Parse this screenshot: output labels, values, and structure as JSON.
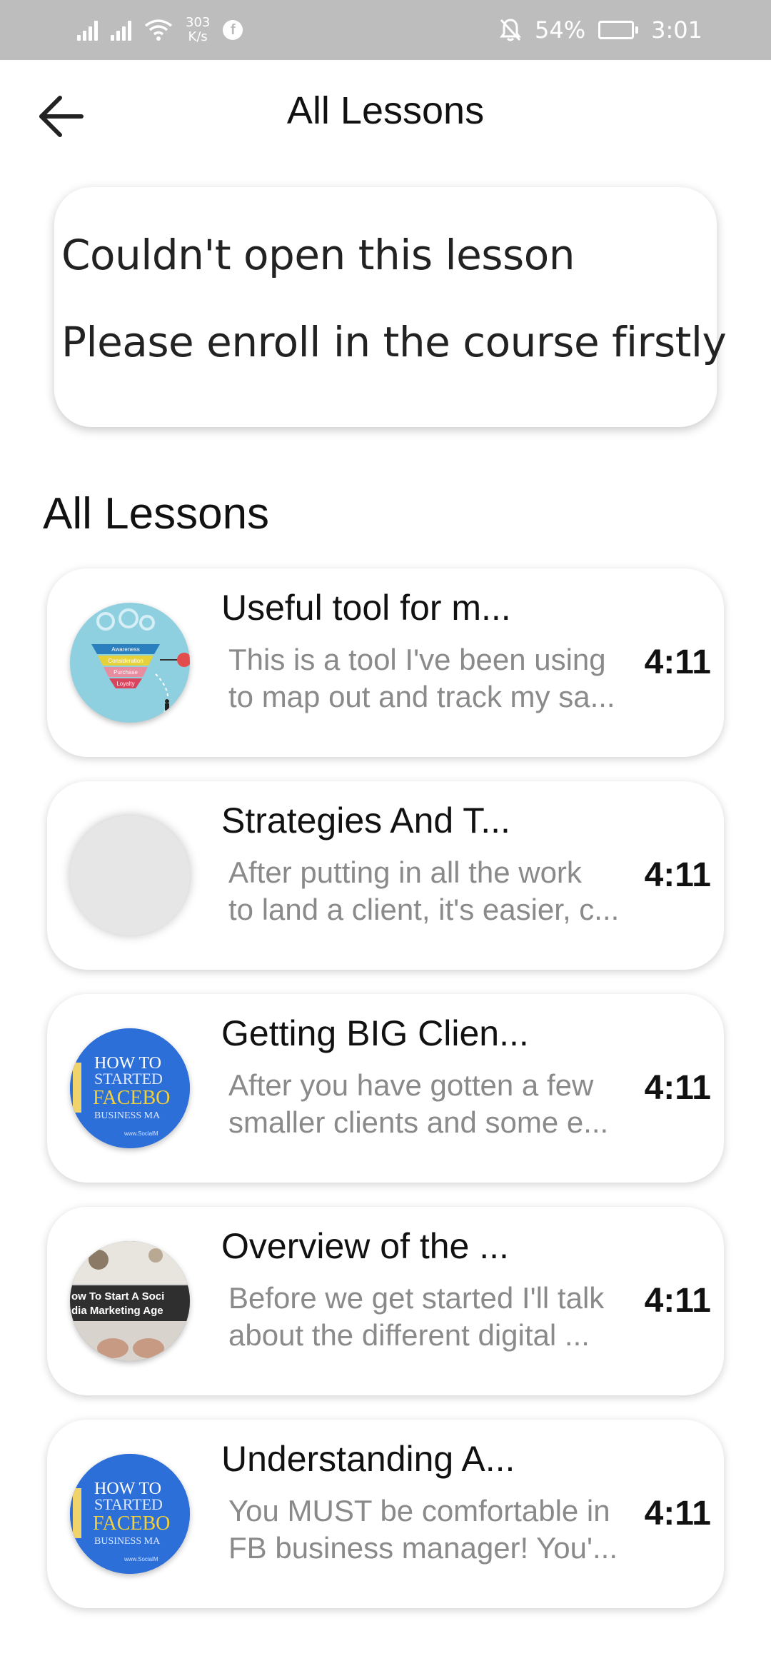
{
  "status_bar": {
    "net_speed_value": "303",
    "net_speed_unit": "K/s",
    "battery": "54%",
    "time": "3:01",
    "battery_level": 0.54,
    "icons": [
      "signal-icon",
      "signal-icon",
      "wifi-icon",
      "facebook-icon",
      "bell-off-icon",
      "battery-icon"
    ]
  },
  "header": {
    "title": "All Lessons"
  },
  "error": {
    "line1": "Couldn't open this lesson",
    "line2": "Please enroll in the course firstly"
  },
  "section": {
    "title": "All Lessons"
  },
  "lessons": [
    {
      "title": "Useful tool for m...",
      "desc_line1": "This is a tool I've been using",
      "desc_line2": "to map out and track my sa...",
      "duration": "4:11",
      "thumb_labels": [
        "Awareness",
        "Consideration",
        "Purchase",
        "Loyalty"
      ]
    },
    {
      "title": "Strategies And T...",
      "desc_line1": "After putting in all the work",
      "desc_line2": "to land a client, it's easier, c...",
      "duration": "4:11"
    },
    {
      "title": "Getting BIG Clien...",
      "desc_line1": "After you have gotten a few",
      "desc_line2": "smaller clients and some e...",
      "duration": "4:11",
      "thumb_lines": [
        "HOW TO",
        "STARTED",
        "FACEBO",
        "BUSINESS MA",
        "www.SocialM"
      ]
    },
    {
      "title": "Overview of the ...",
      "desc_line1": "Before we get started I'll talk",
      "desc_line2": "about the different digital ...",
      "duration": "4:11",
      "thumb_lines": [
        "ow To Start A Soci",
        "dia Marketing Age"
      ]
    },
    {
      "title": "Understanding A...",
      "desc_line1": "You MUST be comfortable in",
      "desc_line2": "FB business manager!  You'...",
      "duration": "4:11",
      "thumb_lines": [
        "HOW TO",
        "STARTED",
        "FACEBO",
        "BUSINESS MA",
        "www.SocialM"
      ]
    }
  ],
  "colors": {
    "status_bar_bg": "#bdbdbd",
    "description_text": "#8a8a8a",
    "card_bg": "#ffffff"
  }
}
